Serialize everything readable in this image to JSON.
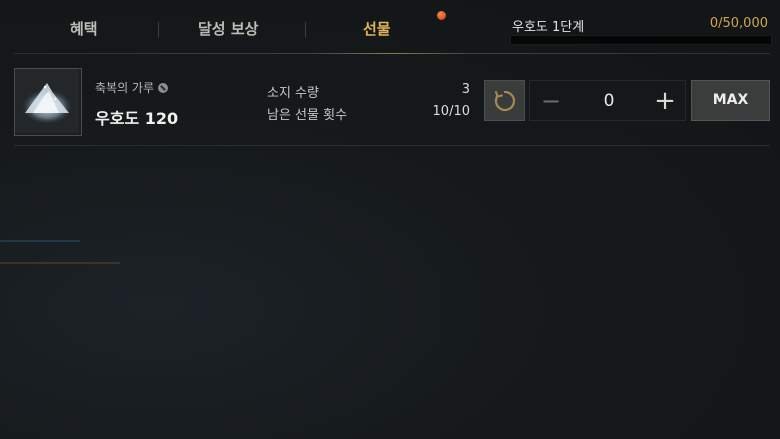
{
  "tabs": [
    {
      "label": "혜택",
      "active": false
    },
    {
      "label": "달성 보상",
      "active": false
    },
    {
      "label": "선물",
      "active": true
    }
  ],
  "stage": {
    "label": "우호도 1단계",
    "value_text": "0/50,000",
    "progress": 0
  },
  "gift_item": {
    "name": "축복의 가루",
    "target": "우호도 120",
    "owned_label": "소지 수량",
    "owned_value": "3",
    "remaining_label": "남은 선물 횟수",
    "remaining_value": "10/10"
  },
  "controls": {
    "minus": "−",
    "quantity": "0",
    "plus": "+",
    "max_label": "MAX"
  },
  "colors": {
    "accent_gold": "#d5a550",
    "active_tab": "#e0b45a",
    "notify": "#c0371a"
  },
  "icons": {
    "item": "blessing-powder-icon",
    "bound": "bound-icon",
    "reset": "reset-icon"
  }
}
